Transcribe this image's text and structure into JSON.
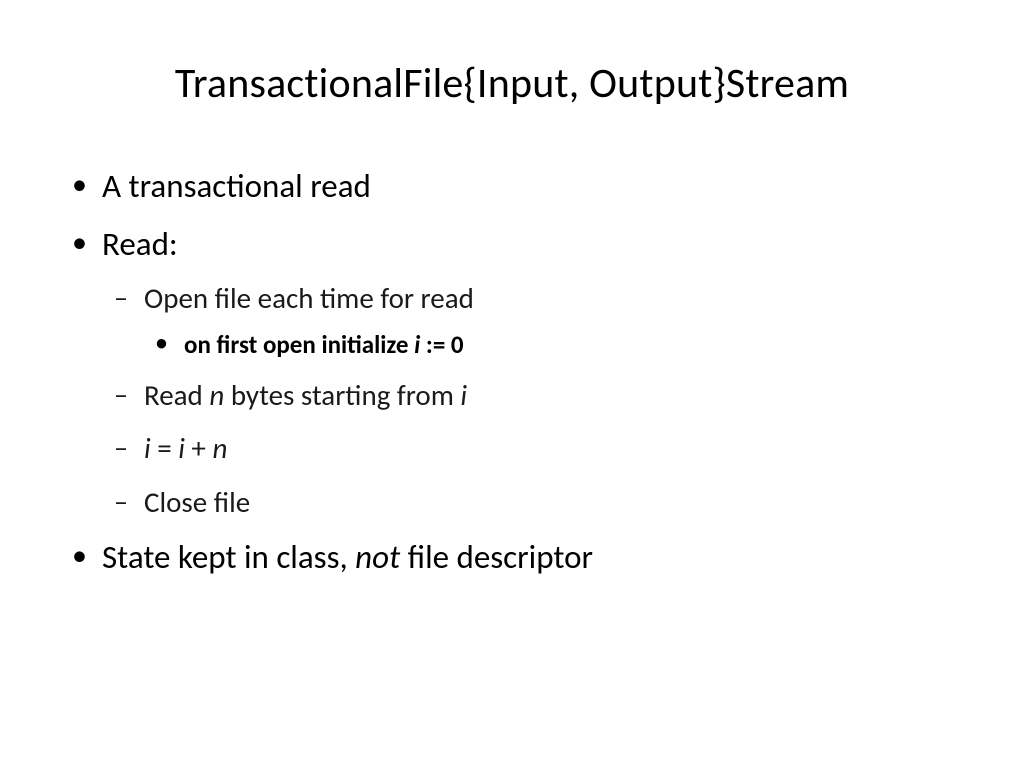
{
  "title": "TransactionalFile{Input, Output}Stream",
  "b1": "A transactional read",
  "b2": "Read:",
  "b2_1_pre": "Open file each time for read",
  "b2_1_1_a": "on first open initialize ",
  "b2_1_1_i": "i",
  "b2_1_1_b": " := 0",
  "b2_2_a": "Read ",
  "b2_2_n": "n",
  "b2_2_b": " bytes starting from ",
  "b2_2_i": "i",
  "b2_3_a": "i",
  "b2_3_b": " = ",
  "b2_3_c": "i",
  "b2_3_d": " + ",
  "b2_3_e": "n",
  "b2_4": "Close file",
  "b3_a": "State kept in class, ",
  "b3_not": "not",
  "b3_b": " file descriptor"
}
